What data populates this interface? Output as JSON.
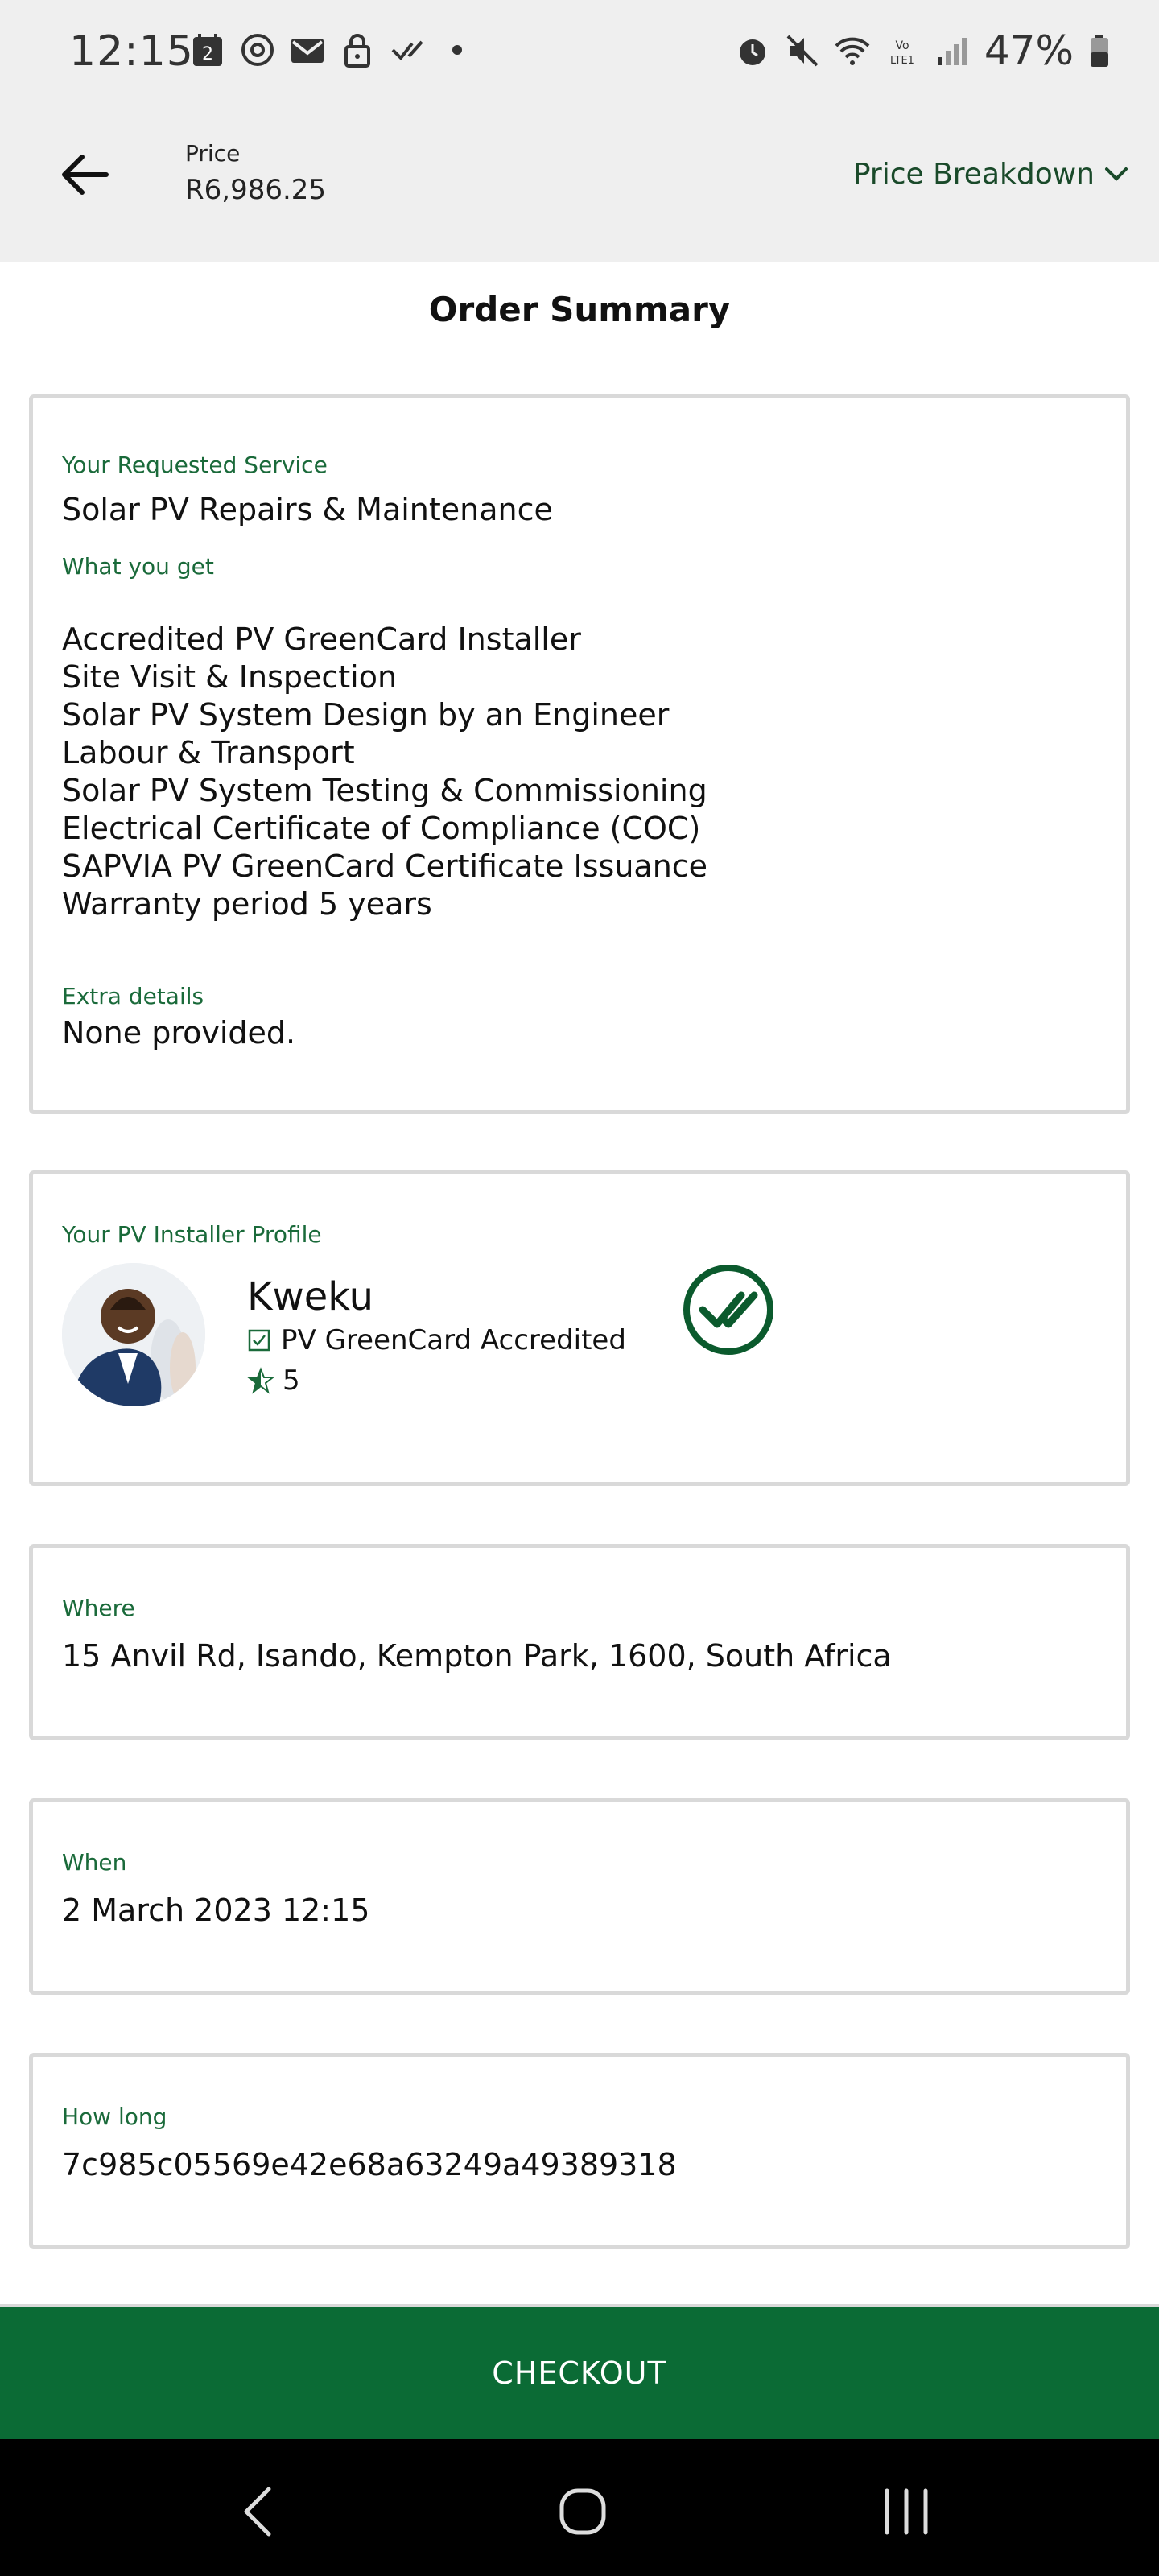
{
  "status_bar": {
    "time": "12:15",
    "calendar_badge": "2",
    "battery": "47%",
    "icons_left": [
      "calendar-icon",
      "sync-icon",
      "mail-icon",
      "lock-icon",
      "check-icon",
      "dot-icon"
    ],
    "icons_right": [
      "alarm-icon",
      "mute-icon",
      "wifi-icon",
      "volte-icon",
      "signal-icon",
      "battery-icon"
    ]
  },
  "header": {
    "price_label": "Price",
    "price_value": "R6,986.25",
    "breakdown_label": "Price Breakdown"
  },
  "page_title": "Order Summary",
  "service_card": {
    "service_label": "Your Requested Service",
    "service_value": "Solar PV Repairs & Maintenance",
    "what_you_get_label": "What you get",
    "items": [
      "Accredited PV GreenCard Installer",
      "Site Visit & Inspection",
      "Solar PV System Design by an Engineer",
      "Labour & Transport",
      "Solar PV System Testing & Commissioning",
      "Electrical Certificate of Compliance (COC)",
      "SAPVIA PV GreenCard Certificate Issuance",
      "Warranty period 5 years"
    ],
    "extra_label": "Extra details",
    "extra_value": "None provided."
  },
  "installer_card": {
    "label": "Your PV Installer Profile",
    "name": "Kweku",
    "accreditation": "PV GreenCard Accredited",
    "rating": "5"
  },
  "where_card": {
    "label": "Where",
    "value": "15 Anvil Rd, Isando, Kempton Park, 1600, South Africa"
  },
  "when_card": {
    "label": "When",
    "value": "2 March 2023 12:15"
  },
  "howlong_card": {
    "label": "How long",
    "value": "7c985c05569e42e68a63249a49389318"
  },
  "checkout_label": "CHECKOUT",
  "colors": {
    "accent": "#0b6b35",
    "label_green": "#1a6a3a",
    "border": "#d9d9d9",
    "header_bg": "#efefef"
  }
}
